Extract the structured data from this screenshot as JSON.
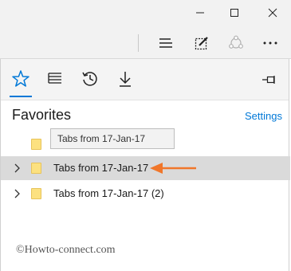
{
  "window": {
    "minimize_icon": "minimize-icon",
    "maximize_icon": "maximize-icon",
    "close_icon": "close-icon"
  },
  "toolbar": {
    "icons": [
      "hub-icon",
      "web-note-icon",
      "share-icon",
      "more-icon"
    ]
  },
  "hub": {
    "tabs": [
      "favorites-star-icon",
      "reading-list-icon",
      "history-icon",
      "downloads-icon"
    ],
    "pin_icon": "pin-icon",
    "title": "Favorites",
    "settings_label": "Settings",
    "tooltip": "Tabs from 17-Jan-17",
    "items": [
      {
        "label": "",
        "expandable": false
      },
      {
        "label": "Tabs from 17-Jan-17",
        "expandable": true,
        "selected": true
      },
      {
        "label": "Tabs from 17-Jan-17 (2)",
        "expandable": true,
        "selected": false
      }
    ]
  },
  "accent_color": "#0078d7",
  "arrow_color": "#f0762a",
  "watermark": "©Howto-connect.com"
}
